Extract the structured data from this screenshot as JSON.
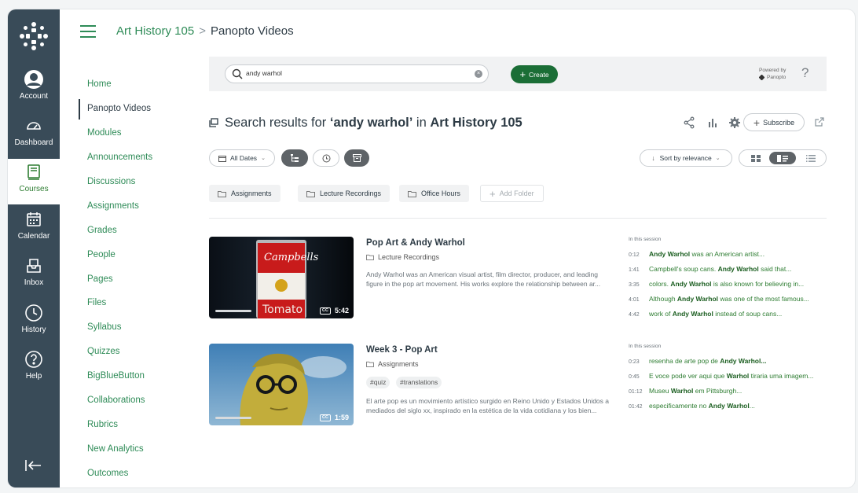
{
  "colors": {
    "nav_bg": "#394b58",
    "accent": "#2e8b57",
    "create_bg": "#1b6e36",
    "text": "#2d3b45"
  },
  "global_nav": {
    "items": [
      {
        "label": "Account",
        "icon": "account-icon"
      },
      {
        "label": "Dashboard",
        "icon": "dashboard-icon"
      },
      {
        "label": "Courses",
        "icon": "courses-icon",
        "active": true
      },
      {
        "label": "Calendar",
        "icon": "calendar-icon"
      },
      {
        "label": "Inbox",
        "icon": "inbox-icon"
      },
      {
        "label": "History",
        "icon": "history-icon"
      },
      {
        "label": "Help",
        "icon": "help-icon"
      }
    ]
  },
  "breadcrumb": {
    "course": "Art History 105",
    "separator": ">",
    "page": "Panopto Videos"
  },
  "course_nav": {
    "items": [
      "Home",
      "Panopto Videos",
      "Modules",
      "Announcements",
      "Discussions",
      "Assignments",
      "Grades",
      "People",
      "Pages",
      "Files",
      "Syllabus",
      "Quizzes",
      "BigBlueButton",
      "Collaborations",
      "Rubrics",
      "New Analytics",
      "Outcomes"
    ],
    "active": "Panopto Videos"
  },
  "panopto": {
    "search_value": "andy warhol",
    "create_label": "Create",
    "powered_by": "Powered by",
    "brand": "Panopto",
    "results": {
      "prefix": "Search results for ",
      "query": "‘andy warhol’",
      "in": " in ",
      "course": "Art History 105"
    },
    "subscribe_label": "Subscribe",
    "filters": {
      "dates": "All Dates",
      "sort": "Sort by relevance"
    },
    "folders": [
      "Assignments",
      "Lecture Recordings",
      "Office Hours"
    ],
    "add_folder": "Add Folder",
    "in_session_label": "In this session",
    "sessions": [
      {
        "title": "Pop Art & Andy Warhol",
        "folder": "Lecture Recordings",
        "duration": "5:42",
        "cc": "CC",
        "description": "Andy Warhol was an American visual artist, film director, producer, and leading figure in the pop art movement. His works explore the relationship between ar...",
        "tags": [],
        "hits": [
          {
            "time": "0:12",
            "pre": "",
            "match": "Andy Warhol",
            "post": " was an American artist..."
          },
          {
            "time": "1:41",
            "pre": "Campbell's soup cans. ",
            "match": "Andy Warhol",
            "post": " said that..."
          },
          {
            "time": "3:35",
            "pre": "colors. ",
            "match": "Andy Warhol",
            "post": " is also known for believing in..."
          },
          {
            "time": "4:01",
            "pre": "Although ",
            "match": "Andy Warhol",
            "post": " was one of the most famous..."
          },
          {
            "time": "4:42",
            "pre": "work of ",
            "match": "Andy Warhol",
            "post": " instead of soup cans..."
          }
        ]
      },
      {
        "title": "Week 3 - Pop Art",
        "folder": "Assignments",
        "duration": "1:59",
        "cc": "CC",
        "description": "El arte pop es un movimiento artístico surgido en Reino Unido y Estados Unidos a mediados del siglo xx, inspirado en la estética de la vida cotidiana y los bien...",
        "tags": [
          "#quiz",
          "#translations"
        ],
        "hits": [
          {
            "time": "0:23",
            "pre": "resenha de arte pop de ",
            "match": "Andy Warhol...",
            "post": ""
          },
          {
            "time": "0:45",
            "pre": "E voce pode ver aqui que ",
            "match": "Warhol",
            "post": " tiraria uma imagem..."
          },
          {
            "time": "01:12",
            "pre": "Museu ",
            "match": "Warhol",
            "post": " em Pittsburgh..."
          },
          {
            "time": "01:42",
            "pre": "especificamente no ",
            "match": "Andy Warhol",
            "post": "..."
          }
        ]
      }
    ]
  }
}
